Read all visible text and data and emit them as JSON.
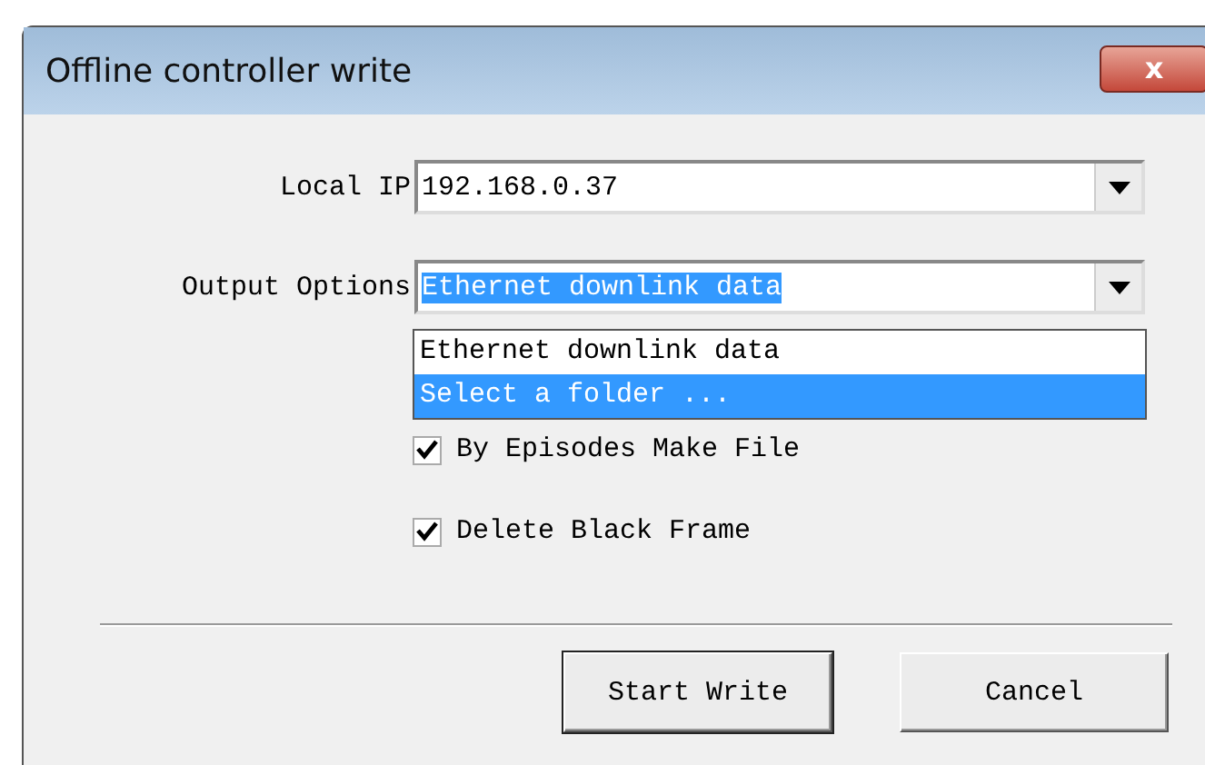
{
  "window": {
    "title": "Offline controller write",
    "close_label": "x"
  },
  "local_ip": {
    "label": "Local IP",
    "value": "192.168.0.37"
  },
  "output_options": {
    "label": "Output Options",
    "value": "Ethernet downlink data",
    "expanded": true,
    "options": [
      {
        "label": "Ethernet downlink data",
        "highlighted": false
      },
      {
        "label": "Select a folder ...",
        "highlighted": true
      }
    ]
  },
  "checkboxes": [
    {
      "label": "By Episodes Make File",
      "checked": true
    },
    {
      "label": "Delete Black Frame",
      "checked": true
    }
  ],
  "buttons": [
    {
      "label": "Start Write",
      "kind": "default"
    },
    {
      "label": "Cancel",
      "kind": "normal"
    }
  ]
}
